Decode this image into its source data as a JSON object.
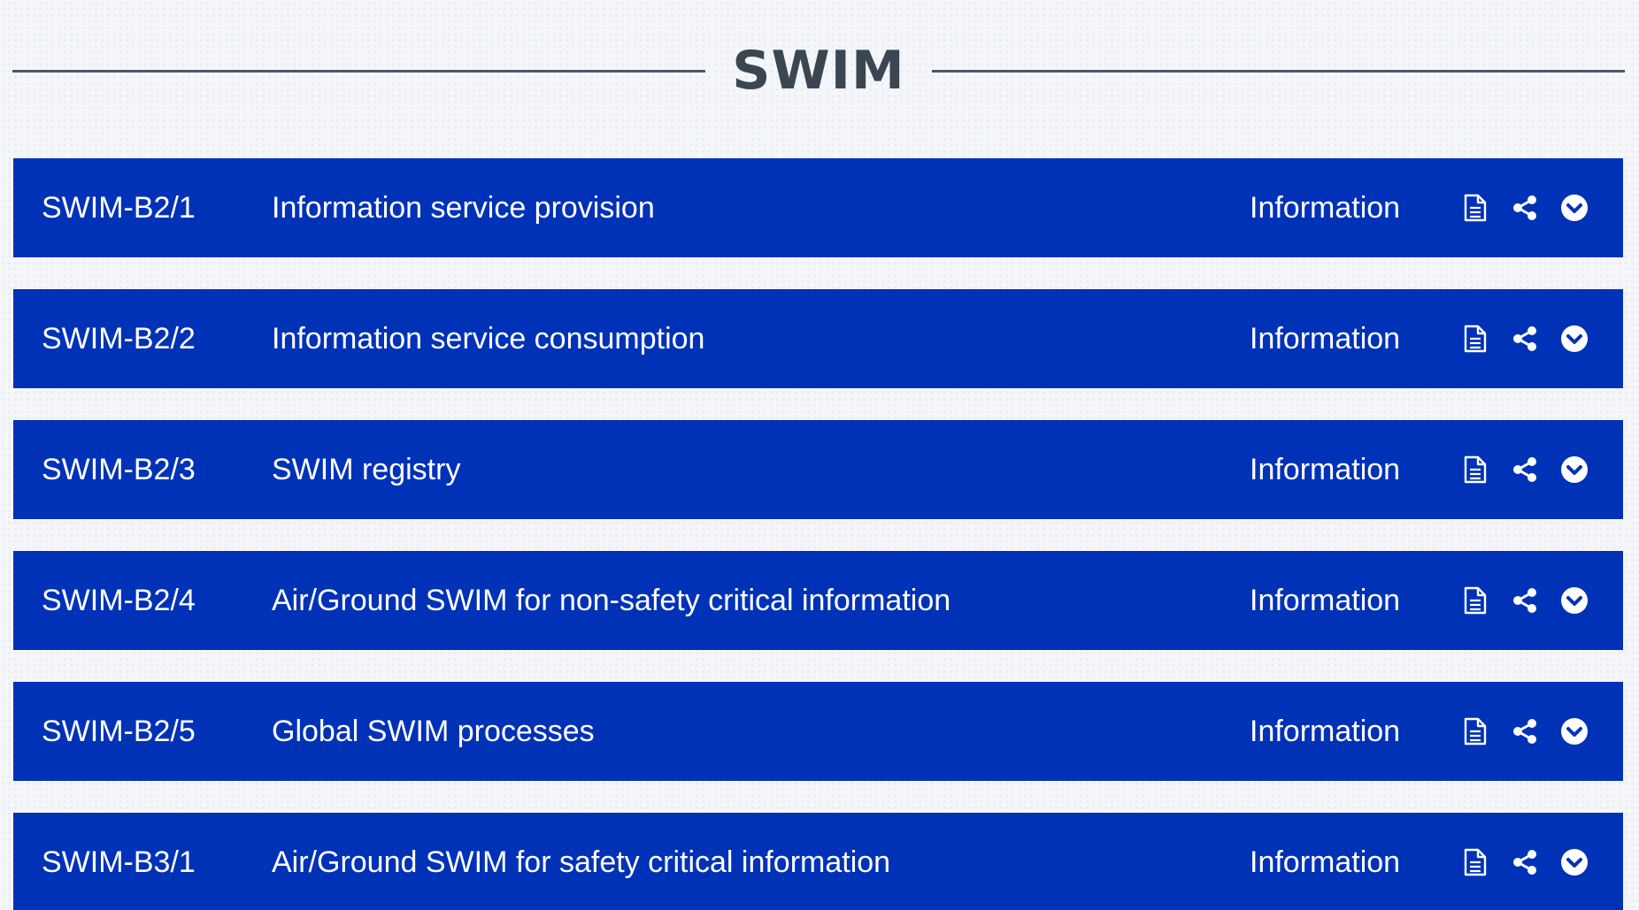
{
  "section": {
    "title": "SWIM"
  },
  "colors": {
    "row_background": "#0032b8",
    "row_text": "#ffffff",
    "title_text": "#3b4653",
    "rule": "#4a5866"
  },
  "icons": {
    "document": "document-icon",
    "share": "share-icon",
    "expand": "chevron-down-circle-icon"
  },
  "rows": [
    {
      "code": "SWIM-B2/1",
      "name": "Information service provision",
      "category": "Information"
    },
    {
      "code": "SWIM-B2/2",
      "name": "Information service consumption",
      "category": "Information"
    },
    {
      "code": "SWIM-B2/3",
      "name": "SWIM registry",
      "category": "Information"
    },
    {
      "code": "SWIM-B2/4",
      "name": "Air/Ground SWIM for non-safety critical information",
      "category": "Information"
    },
    {
      "code": "SWIM-B2/5",
      "name": "Global SWIM processes",
      "category": "Information"
    },
    {
      "code": "SWIM-B3/1",
      "name": "Air/Ground SWIM for safety critical information",
      "category": "Information"
    }
  ]
}
